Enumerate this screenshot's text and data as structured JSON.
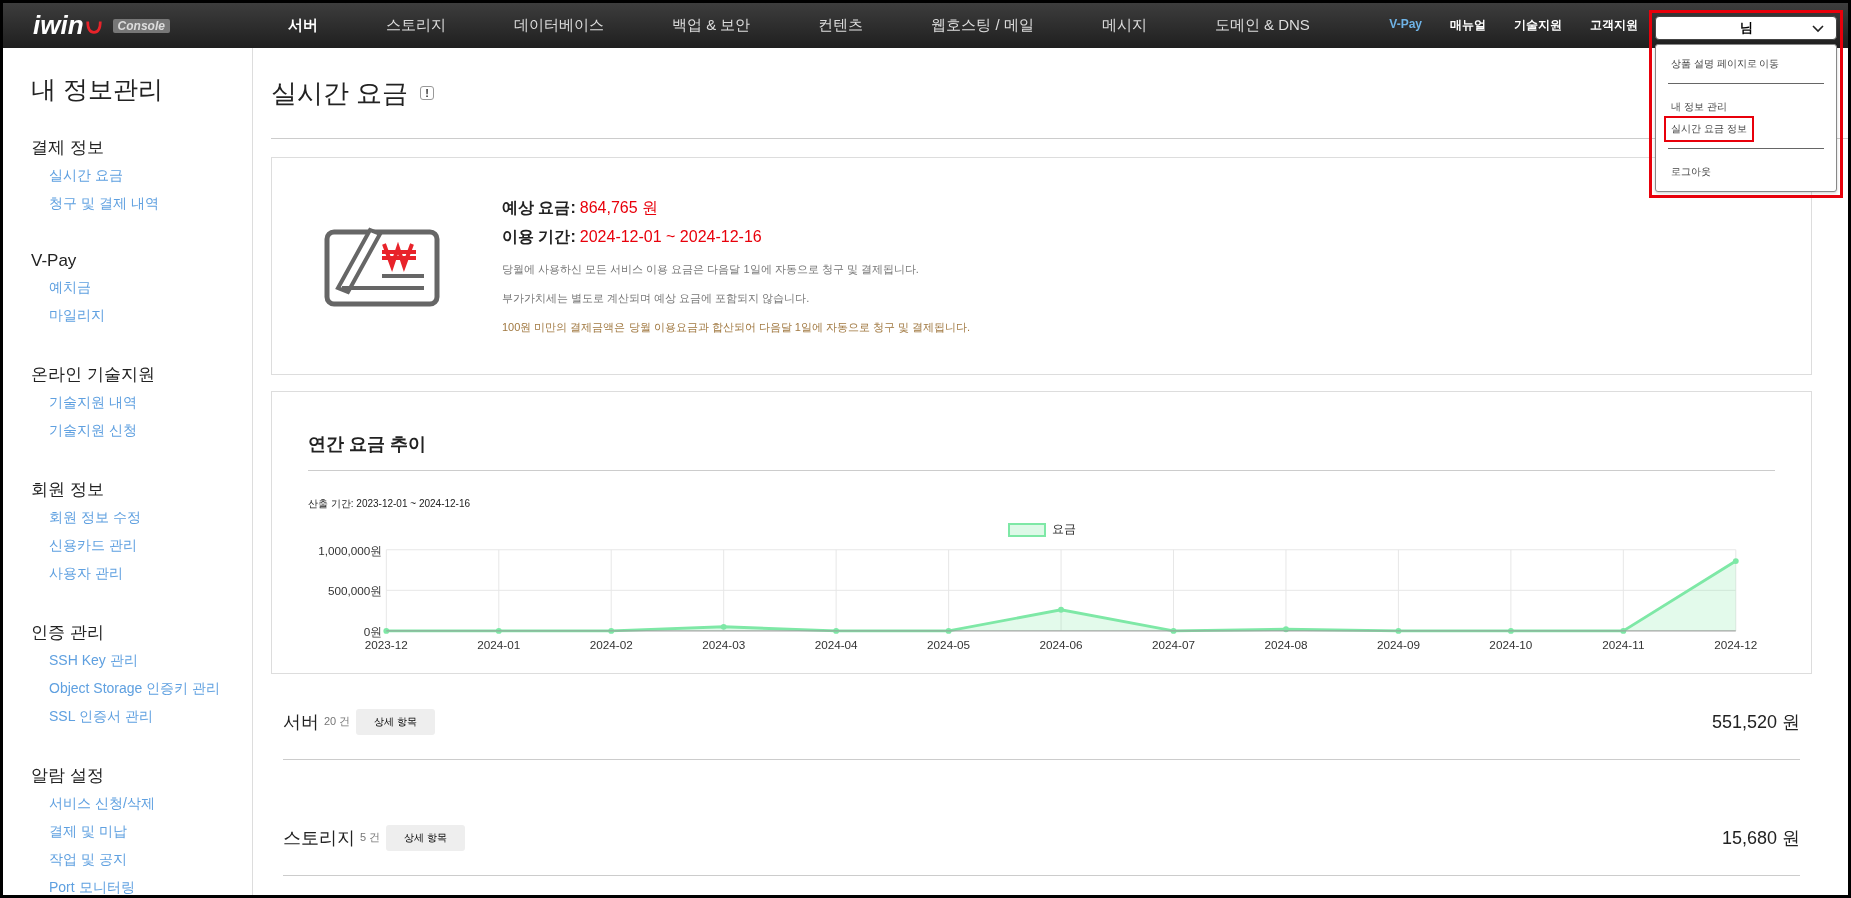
{
  "header": {
    "logo": "iwin",
    "logo_badge": "Console",
    "nav": [
      {
        "label": "서버",
        "selected": true
      },
      {
        "label": "스토리지",
        "selected": false
      },
      {
        "label": "데이터베이스",
        "selected": false
      },
      {
        "label": "백업 & 보안",
        "selected": false
      },
      {
        "label": "컨텐츠",
        "selected": false
      },
      {
        "label": "웹호스팅 / 메일",
        "selected": false
      },
      {
        "label": "메시지",
        "selected": false
      },
      {
        "label": "도메인 & DNS",
        "selected": false
      }
    ],
    "links": [
      {
        "label": "V-Pay",
        "kind": "accent"
      },
      {
        "label": "매뉴얼",
        "kind": "plain"
      },
      {
        "label": "기술지원",
        "kind": "plain"
      },
      {
        "label": "고객지원",
        "kind": "plain"
      }
    ],
    "user_menu": {
      "label": "님",
      "expanded": true,
      "highlighted": true,
      "items": [
        {
          "label": "상품 설명 페이지로 이동",
          "highlighted": false,
          "divider_after": true
        },
        {
          "label": "내 정보 관리",
          "highlighted": false,
          "divider_after": false
        },
        {
          "label": "실시간 요금 정보",
          "highlighted": true,
          "divider_after": true
        },
        {
          "label": "로그아웃",
          "highlighted": false,
          "divider_after": false
        }
      ]
    }
  },
  "sidebar": {
    "title": "내 정보관리",
    "groups": [
      {
        "title": "결제 정보",
        "items": [
          "실시간 요금",
          "청구 및 결제 내역"
        ]
      },
      {
        "title": "V-Pay",
        "items": [
          "예치금",
          "마일리지"
        ]
      },
      {
        "title": "온라인 기술지원",
        "items": [
          "기술지원 내역",
          "기술지원 신청"
        ]
      },
      {
        "title": "회원 정보",
        "items": [
          "회원 정보 수정",
          "신용카드 관리",
          "사용자 관리"
        ]
      },
      {
        "title": "인증 관리",
        "items": [
          "SSH Key 관리",
          "Object Storage 인증키 관리",
          "SSL 인증서 관리"
        ]
      },
      {
        "title": "알람 설정",
        "items": [
          "서비스 신청/삭제",
          "결제 및 미납",
          "작업 및 공지",
          "Port 모니터링"
        ]
      }
    ]
  },
  "page": {
    "title": "실시간 요금",
    "info_badge": "!",
    "summary": {
      "estimate_label": "예상 요금:",
      "estimate_value": "864,765 원",
      "period_label": "이용 기간:",
      "period_value": "2024-12-01 ~ 2024-12-16",
      "notes": [
        {
          "text": "당월에 사용하신 모든 서비스 이용 요금은 다음달 1일에 자동으로 청구 및 결제됩니다.",
          "kind": "plain"
        },
        {
          "text": "부가가치세는 별도로 계산되며 예상 요금에 포함되지 않습니다.",
          "kind": "plain"
        },
        {
          "text": "100원 미만의 결제금액은 당월 이용요금과 합산되어 다음달 1일에 자동으로 청구 및 결제됩니다.",
          "kind": "warning"
        }
      ]
    },
    "trend": {
      "title": "연간 요금 추이",
      "period": "산출 기간: 2023-12-01 ~ 2024-12-16",
      "chart_data": {
        "type": "area",
        "categories": [
          "2023-12",
          "2024-01",
          "2024-02",
          "2024-03",
          "2024-04",
          "2024-05",
          "2024-06",
          "2024-07",
          "2024-08",
          "2024-09",
          "2024-10",
          "2024-11",
          "2024-12"
        ],
        "series": [
          {
            "name": "요금",
            "color": "#7ee8a6",
            "values": [
              0,
              0,
              0,
              50000,
              0,
              0,
              260000,
              0,
              20000,
              0,
              0,
              0,
              860000
            ]
          }
        ],
        "grid": true,
        "ylim": [
          0,
          1000000
        ],
        "yticks": [
          {
            "value": 0,
            "label": "0원"
          },
          {
            "value": 500000,
            "label": "500,000원"
          },
          {
            "value": 1000000,
            "label": "1,000,000원"
          }
        ]
      }
    },
    "sections": [
      {
        "name": "서버",
        "count": "20 건",
        "button": "상세 항목",
        "amount": "551,520 원"
      },
      {
        "name": "스토리지",
        "count": "5 건",
        "button": "상세 항목",
        "amount": "15,680 원"
      }
    ]
  }
}
